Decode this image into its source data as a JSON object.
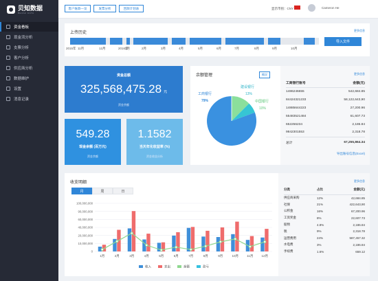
{
  "brand": {
    "name": "贝知数据",
    "sub": "BEIZHI DATA"
  },
  "sidebar": {
    "items": [
      {
        "label": "资金看板",
        "icon": "grid-icon",
        "active": true
      },
      {
        "label": "现金流分析",
        "icon": "chart-icon"
      },
      {
        "label": "支票分析",
        "icon": "check-icon"
      },
      {
        "label": "客户分析",
        "icon": "user-icon"
      },
      {
        "label": "供应商分析",
        "icon": "truck-icon"
      },
      {
        "label": "数据维护",
        "icon": "database-icon"
      },
      {
        "label": "设置",
        "icon": "gear-icon"
      },
      {
        "label": "消息记录",
        "icon": "message-icon"
      }
    ]
  },
  "topbar": {
    "buttons": [
      "客户账款一览",
      "发票分析",
      "回款计划表"
    ],
    "currency": "显示币别：CNY",
    "user": "Cameron He"
  },
  "upload": {
    "title": "上传历史",
    "more": "更多信息",
    "button": "导入文件",
    "labels": [
      "2015年",
      "11月",
      "12月",
      "2016年",
      "1月",
      "2月",
      "3月",
      "4月",
      "5月",
      "6月",
      "7月",
      "8月",
      "9月",
      "10月"
    ]
  },
  "kpi": {
    "total": {
      "label": "资金总额",
      "value": "325,568,475.28",
      "unit": "元",
      "link": "资金余额"
    },
    "cash": {
      "value": "549.28",
      "label": "现金余额 (百万元)",
      "link": "资金余额"
    },
    "rate": {
      "value": "1.1582",
      "label": "当天年化收益率 (%)",
      "link": "资金收益分析"
    }
  },
  "balance": {
    "title": "余额管理",
    "tag": "概况",
    "pie_labels": [
      {
        "name": "工商银行",
        "pct": "79%"
      },
      {
        "name": "建设银行",
        "pct": "13%"
      },
      {
        "name": "中国银行",
        "pct": "10%"
      }
    ]
  },
  "accounts": {
    "more": "更多信息",
    "header": [
      "工商银行账号",
      "金额(元)"
    ],
    "rows": [
      [
        "1486246655",
        "542,684.85"
      ],
      [
        "84424321233",
        "58,122,643,90"
      ],
      [
        "14885644223",
        "27,200.96"
      ],
      [
        "55483521484",
        "61,607.73"
      ],
      [
        "652256234",
        "2,186.84"
      ],
      [
        "9842301553",
        "2,318.78"
      ]
    ],
    "total_label": "总计",
    "total": "67,255,864.34",
    "export": "导出账号信息(Excel)"
  },
  "cashflow": {
    "title": "收支明细",
    "more": "更多信息",
    "tabs": [
      "月",
      "周",
      "日"
    ],
    "active_tab": 0
  },
  "distribution": {
    "header": [
      "分类",
      "占比",
      "金额(元)"
    ],
    "rows": [
      [
        "供应商采购",
        "12%",
        "42,684.85"
      ],
      [
        "社保",
        "21%",
        "422,643,90"
      ],
      [
        "公积金",
        "16%",
        "67,200.96"
      ],
      [
        "工资奖金",
        "8%",
        "22,607.73"
      ],
      [
        "股物",
        "4.8%",
        "2,186.84"
      ],
      [
        "税",
        "9%",
        "2,318.78"
      ],
      [
        "运营费用",
        "24%",
        "587,457.32"
      ],
      [
        "水电费",
        "3%",
        "2,186.84"
      ],
      [
        "手续费",
        "1.6%",
        "659.12"
      ]
    ]
  },
  "chart_data": {
    "type": "bar",
    "categories": [
      "1月",
      "2月",
      "3月",
      "4月",
      "5月",
      "6月",
      "7月",
      "8月",
      "9月",
      "10月",
      "11月",
      "12月"
    ],
    "ylim": [
      0,
      100000000
    ],
    "yticks": [
      "100,000,000",
      "90,000,000",
      "60,000,000",
      "40,000,000",
      "20,000,000",
      "10,000,000",
      "0"
    ],
    "series": [
      {
        "name": "收入",
        "type": "bar",
        "color": "#3f8fd9",
        "values": [
          10000000,
          26000000,
          48000000,
          25000000,
          18000000,
          33000000,
          49000000,
          31000000,
          30000000,
          36000000,
          24000000,
          29000000
        ]
      },
      {
        "name": "支出",
        "type": "bar",
        "color": "#ef6c6c",
        "values": [
          14000000,
          45000000,
          84000000,
          37000000,
          19000000,
          40000000,
          51000000,
          43000000,
          50000000,
          62000000,
          32000000,
          47000000
        ]
      },
      {
        "name": "余额",
        "type": "line",
        "color": "#8fd88f",
        "values": [
          4000000,
          21000000,
          38000000,
          13000000,
          3000000,
          9000000,
          4000000,
          11000000,
          20000000,
          26000000,
          10000000,
          20000000
        ]
      },
      {
        "name": "盈亏",
        "type": "bar",
        "color": "#36c1df",
        "values": [
          0,
          0,
          0,
          0,
          0,
          0,
          0,
          0,
          0,
          0,
          0,
          0
        ]
      }
    ]
  }
}
